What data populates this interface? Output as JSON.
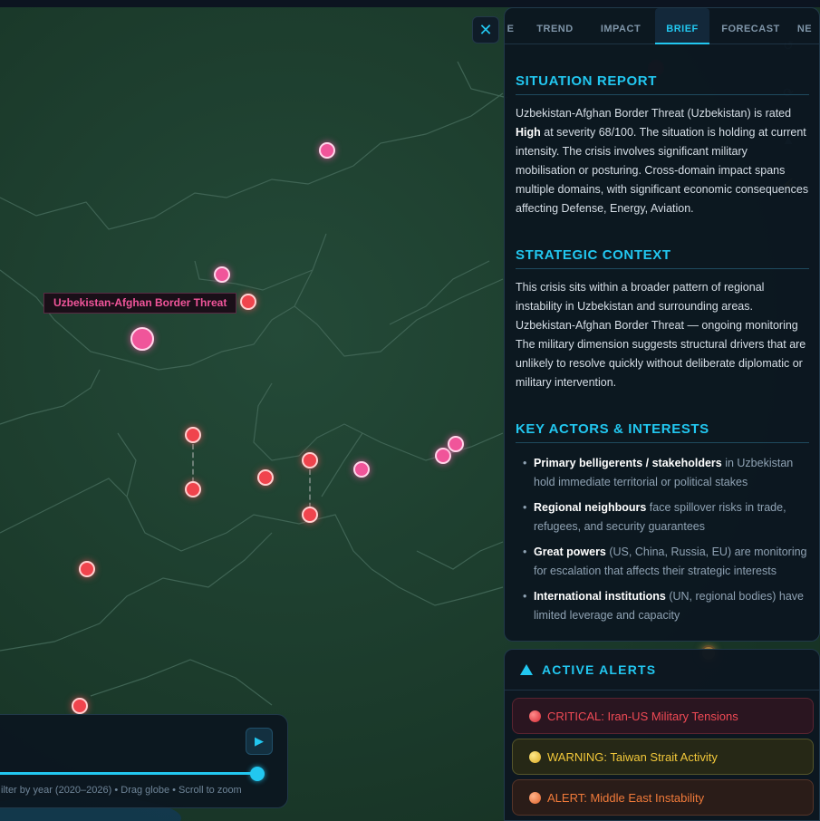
{
  "map": {
    "tooltip": "Uzbekistan-Afghan Border Threat",
    "markers": [
      {
        "id": "m1",
        "kind": "pink"
      },
      {
        "id": "m2",
        "kind": "pink"
      },
      {
        "id": "m3",
        "kind": "red"
      },
      {
        "id": "m4",
        "kind": "pink-big"
      },
      {
        "id": "m5",
        "kind": "red"
      },
      {
        "id": "m6",
        "kind": "red"
      },
      {
        "id": "m7",
        "kind": "red"
      },
      {
        "id": "m8",
        "kind": "red"
      },
      {
        "id": "m9",
        "kind": "red"
      },
      {
        "id": "m10",
        "kind": "pink"
      },
      {
        "id": "m11",
        "kind": "pink"
      },
      {
        "id": "m12",
        "kind": "pink"
      },
      {
        "id": "m13",
        "kind": "red"
      },
      {
        "id": "m14",
        "kind": "red"
      }
    ]
  },
  "icons": {
    "close": "close-icon",
    "play": "play-icon",
    "alert": "warning-triangle-icon"
  },
  "close_glyph": "✕",
  "play_glyph": "▶",
  "tabs": [
    {
      "label": "E",
      "active": false
    },
    {
      "label": "TREND",
      "active": false
    },
    {
      "label": "IMPACT",
      "active": false
    },
    {
      "label": "BRIEF",
      "active": true
    },
    {
      "label": "FORECAST",
      "active": false
    },
    {
      "label": "NE",
      "active": false
    }
  ],
  "brief": {
    "situation": {
      "title": "SITUATION REPORT",
      "p1": "Uzbekistan-Afghan Border Threat (Uzbekistan) is rated ",
      "rating": "High",
      "p2": " at severity 68/100. The situation is holding at current intensity. The crisis involves significant military mobilisation or posturing. Cross-domain impact spans multiple domains, with significant economic consequences affecting Defense, Energy, Aviation."
    },
    "context": {
      "title": "STRATEGIC CONTEXT",
      "text": "This crisis sits within a broader pattern of regional instability in Uzbekistan and surrounding areas. Uzbekistan-Afghan Border Threat — ongoing monitoring The military dimension suggests structural drivers that are unlikely to resolve quickly without deliberate diplomatic or military intervention."
    },
    "actors": {
      "title": "KEY ACTORS & INTERESTS",
      "items": [
        {
          "bold": "Primary belligerents / stakeholders",
          "rest": " in Uzbekistan hold immediate territorial or political stakes"
        },
        {
          "bold": "Regional neighbours",
          "rest": " face spillover risks in trade, refugees, and security guarantees"
        },
        {
          "bold": "Great powers",
          "rest": " (US, China, Russia, EU) are monitoring for escalation that affects their strategic interests"
        },
        {
          "bold": "International institutions",
          "rest": " (UN, regional bodies) have limited leverage and capacity"
        }
      ]
    }
  },
  "alerts": {
    "title": "ACTIVE ALERTS",
    "items": [
      {
        "level": "critical",
        "text": "CRITICAL: Iran-US Military Tensions",
        "color": "#f04a55"
      },
      {
        "level": "warning",
        "text": "WARNING: Taiwan Strait Activity",
        "color": "#f2c83a"
      },
      {
        "level": "alert",
        "text": "ALERT: Middle East Instability",
        "color": "#f07a3a"
      }
    ]
  },
  "timeline": {
    "hint": "ilter by year (2020–2026) • Drag globe • Scroll to zoom",
    "position": 1.0
  },
  "colors": {
    "accent": "#22c7f0",
    "map_land": "#1c3e30",
    "marker_red": "#f0444d",
    "marker_pink": "#f0559a"
  }
}
